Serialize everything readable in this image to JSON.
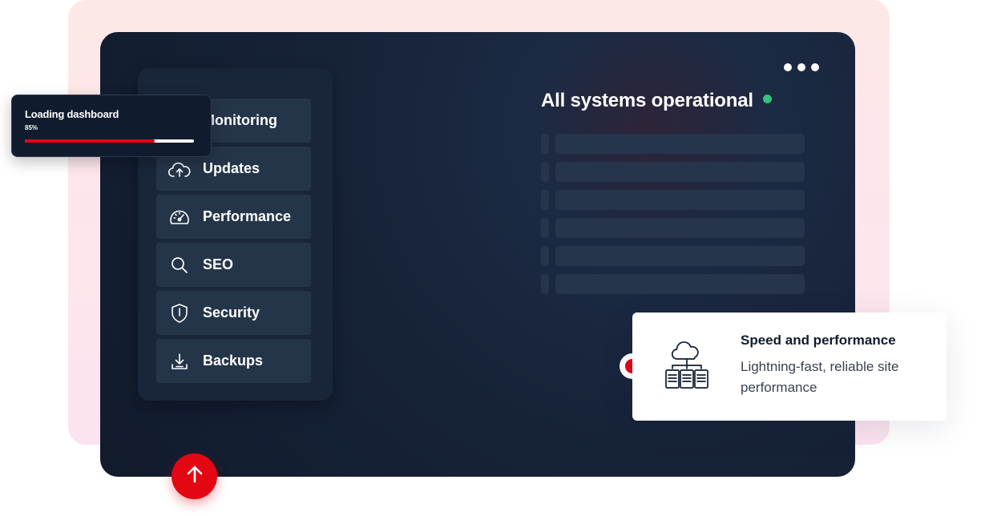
{
  "status": {
    "title": "All systems operational",
    "indicator_color": "#33c27d",
    "menu_icon": "more-dots-icon"
  },
  "sidebar": {
    "items": [
      {
        "label": "Monitoring",
        "icon": "monitoring-icon"
      },
      {
        "label": "Updates",
        "icon": "cloud-upload-icon"
      },
      {
        "label": "Performance",
        "icon": "speedometer-icon"
      },
      {
        "label": "SEO",
        "icon": "search-icon"
      },
      {
        "label": "Security",
        "icon": "shield-icon"
      },
      {
        "label": "Backups",
        "icon": "download-icon"
      }
    ]
  },
  "loading": {
    "title": "Loading dashboard",
    "percent_label": "85%",
    "progress": 0.77,
    "bar_color": "#e30613"
  },
  "feature_card": {
    "title": "Speed and performance",
    "description": "Lightning-fast, reliable site performance",
    "icon": "cloud-servers-icon"
  },
  "actions": {
    "scroll_top_icon": "arrow-up-icon",
    "accent_color": "#e30613"
  }
}
